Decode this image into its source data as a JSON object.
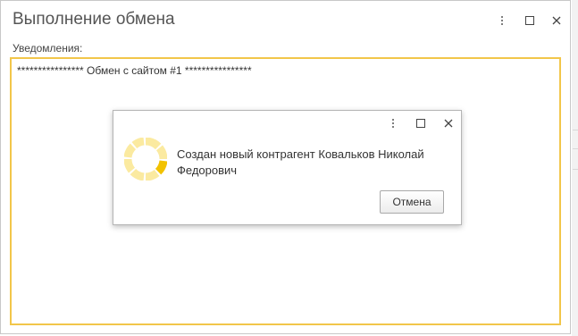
{
  "window": {
    "title": "Выполнение обмена",
    "more_icon": "more-vertical-icon",
    "maximize_icon": "maximize-icon",
    "close_icon": "close-icon"
  },
  "notifications": {
    "label": "Уведомления:",
    "lines": [
      "**************** Обмен с сайтом #1 ****************"
    ]
  },
  "dialog": {
    "message": "Создан новый контрагент Ковальков Николай Федорович",
    "cancel_label": "Отмена",
    "spinner_icon": "loading-spinner-icon",
    "more_icon": "more-vertical-icon",
    "maximize_icon": "maximize-icon",
    "close_icon": "close-icon"
  },
  "colors": {
    "focus_border": "#f2c64a",
    "spinner_light": "#fbeaa0",
    "spinner_dark": "#f2c200"
  }
}
